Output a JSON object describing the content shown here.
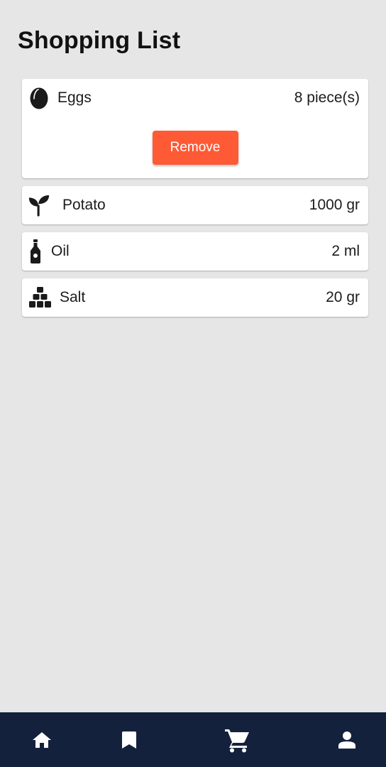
{
  "page": {
    "title": "Shopping List"
  },
  "items": [
    {
      "name": "Eggs",
      "quantity": "8 piece(s)",
      "icon": "egg-icon",
      "expanded": true
    },
    {
      "name": "Potato",
      "quantity": "1000 gr",
      "icon": "sprout-icon",
      "expanded": false
    },
    {
      "name": "Oil",
      "quantity": "2 ml",
      "icon": "bottle-icon",
      "expanded": false
    },
    {
      "name": "Salt",
      "quantity": "20 gr",
      "icon": "cubes-icon",
      "expanded": false
    }
  ],
  "actions": {
    "remove_label": "Remove"
  },
  "bottom_nav": {
    "items": [
      {
        "icon": "home-icon",
        "active": false
      },
      {
        "icon": "bookmark-icon",
        "active": false
      },
      {
        "icon": "cart-icon",
        "active": true
      },
      {
        "icon": "person-icon",
        "active": false
      }
    ]
  },
  "colors": {
    "background": "#e6e6e6",
    "card": "#ffffff",
    "accent": "#fd5a35",
    "nav_background": "#14213d",
    "nav_icon": "#ffffff"
  }
}
